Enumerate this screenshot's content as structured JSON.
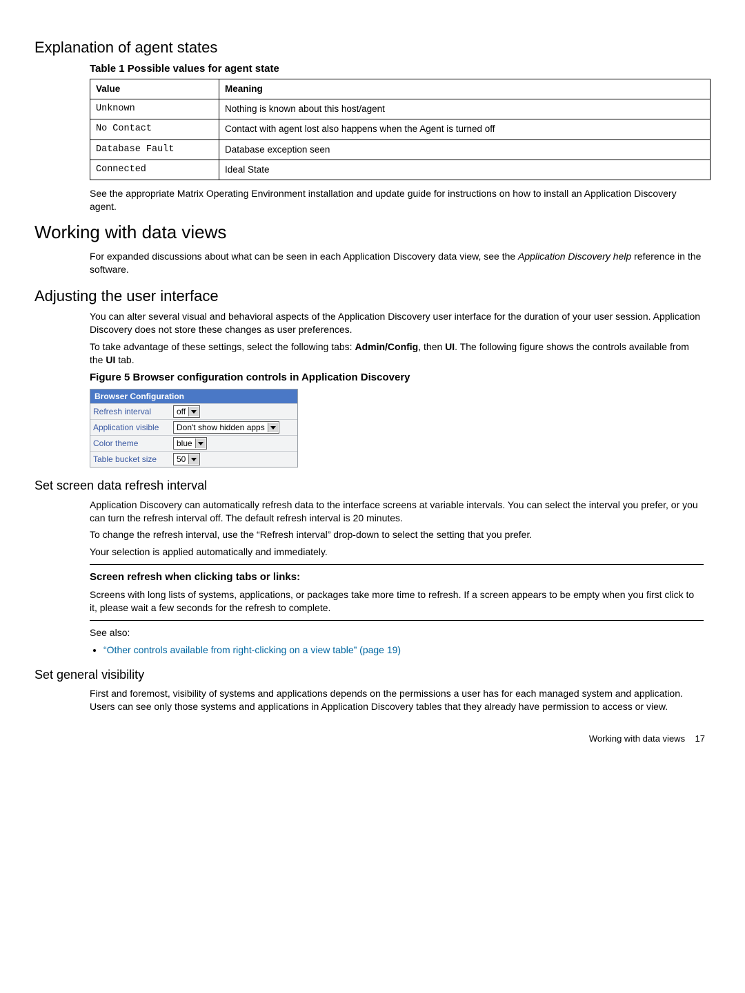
{
  "h_agent_states": "Explanation of agent states",
  "table_caption": "Table 1 Possible values for agent state",
  "table_headers": {
    "value": "Value",
    "meaning": "Meaning"
  },
  "table_rows": [
    {
      "value": "Unknown",
      "meaning": "Nothing is known about this host/agent"
    },
    {
      "value": "No Contact",
      "meaning": "Contact with agent lost also happens when the Agent is turned off"
    },
    {
      "value": "Database Fault",
      "meaning": "Database exception seen"
    },
    {
      "value": "Connected",
      "meaning": "Ideal State"
    }
  ],
  "p_after_table": "See the appropriate Matrix Operating Environment installation and update guide for instructions on how to install an Application Discovery agent.",
  "h_working": "Working with data views",
  "p_working_1a": "For expanded discussions about what can be seen in each Application Discovery data view, see the ",
  "p_working_1b": "Application Discovery help",
  "p_working_1c": " reference in the software.",
  "h_adjusting": "Adjusting the user interface",
  "p_adj_1": "You can alter several visual and behavioral aspects of the Application Discovery user interface for the duration of your user session. Application Discovery does not store these changes as user preferences.",
  "p_adj_2a": "To take advantage of these settings, select the following tabs: ",
  "p_adj_2b": "Admin/Config",
  "p_adj_2c": ", then ",
  "p_adj_2d": "UI",
  "p_adj_2e": ". The following figure shows the controls available from the ",
  "p_adj_2f": "UI",
  "p_adj_2g": " tab.",
  "fig_caption": "Figure 5 Browser configuration controls in Application Discovery",
  "fig": {
    "title": "Browser Configuration",
    "rows": {
      "refresh_lbl": "Refresh interval",
      "refresh_val": "off",
      "vis_lbl": "Application visible",
      "vis_val": "Don't show hidden apps",
      "color_lbl": "Color theme",
      "color_val": "blue",
      "bucket_lbl": "Table bucket size",
      "bucket_val": "50"
    }
  },
  "h_refresh": "Set screen data refresh interval",
  "p_ref_1": "Application Discovery can automatically refresh data to the interface screens at variable intervals. You can select the interval you prefer, or you can turn the refresh interval off. The default refresh interval is 20 minutes.",
  "p_ref_2": "To change the refresh interval, use the “Refresh interval” drop-down to select the setting that you prefer.",
  "p_ref_3": "Your selection is applied automatically and immediately.",
  "note_title": "Screen refresh when clicking tabs or links:",
  "note_body": "Screens with long lists of systems, applications, or packages take more time to refresh. If a screen appears to be empty when you first click to it, please wait a few seconds for the refresh to complete.",
  "see_also": "See also:",
  "see_also_link": "“Other controls available from right-clicking on a view table” (page 19)",
  "h_visibility": "Set general visibility",
  "p_vis_1": "First and foremost, visibility of systems and applications depends on the permissions a user has for each managed system and application. Users can see only those systems and applications in Application Discovery tables that they already have permission to access or view.",
  "footer_text": "Working with data views",
  "footer_page": "17"
}
